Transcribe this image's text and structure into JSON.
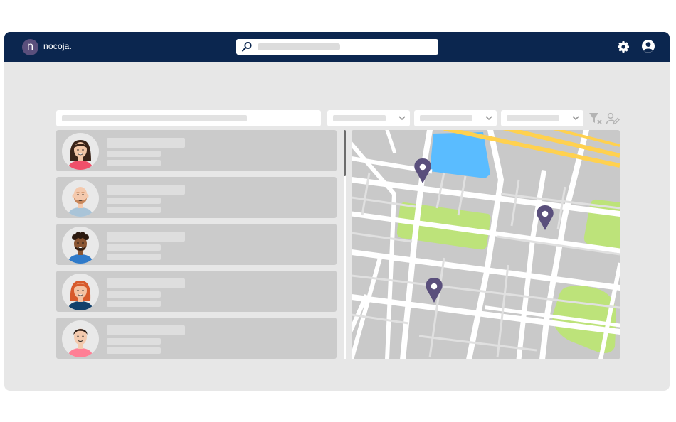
{
  "app": {
    "logo_letter": "n",
    "name": "nocoja."
  },
  "header": {
    "search_icon": "search-icon",
    "settings_icon": "gear-icon",
    "account_icon": "user-account-icon"
  },
  "filters": {
    "icons": [
      "clear-filter-icon",
      "edit-user-icon"
    ],
    "dropdown_icon": "chevron-down-icon"
  },
  "people": [
    {
      "avatar": "woman-dark-hair",
      "shirt": "#f0506a",
      "hair": "#3a2418",
      "skin": "#f2c6a6"
    },
    {
      "avatar": "bald-man-beard",
      "shirt": "#a9c4d8",
      "hair": "#c8875b",
      "skin": "#f4c9ad"
    },
    {
      "avatar": "man-curly-hair",
      "shirt": "#2f7ac9",
      "hair": "#2b1a10",
      "skin": "#8a5532"
    },
    {
      "avatar": "woman-red-hair",
      "shirt": "#12406b",
      "hair": "#d75a2c",
      "skin": "#f3c3a4"
    },
    {
      "avatar": "man-dark-hair",
      "shirt": "#ff7f95",
      "hair": "#2a1b14",
      "skin": "#f4caae"
    }
  ],
  "map": {
    "pin_icon": "map-pin-icon",
    "pin_color": "#5a4f7c",
    "water_color": "#5abcff",
    "park_color": "#bde37a",
    "highway_color": "#ffd14f"
  },
  "colors": {
    "topbar": "#0b264f",
    "background": "#e7e7e7",
    "card": "#cbcbcb"
  }
}
